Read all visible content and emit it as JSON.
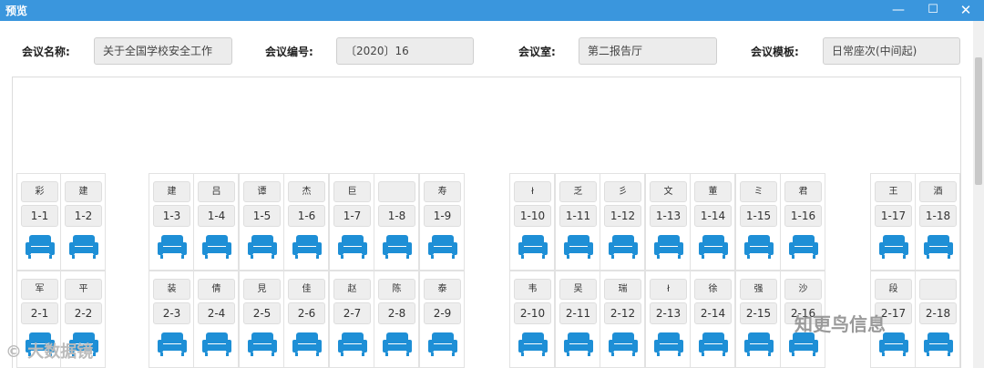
{
  "window": {
    "title": "预览",
    "minimize_glyph": "—",
    "maximize_glyph": "☐",
    "close_glyph": "✕"
  },
  "form": {
    "meeting_name_label": "会议名称:",
    "meeting_name_value": "关于全国学校安全工作",
    "meeting_number_label": "会议编号:",
    "meeting_number_value": "〔2020〕16",
    "meeting_room_label": "会议室:",
    "meeting_room_value": "第二报告厅",
    "meeting_template_label": "会议模板:",
    "meeting_template_value": "日常座次(中间起)"
  },
  "seats_row1": [
    {
      "num": "1-1",
      "name": "彩"
    },
    {
      "num": "1-2",
      "name": "建"
    },
    {
      "num": "1-3",
      "name": "建"
    },
    {
      "num": "1-4",
      "name": "吕"
    },
    {
      "num": "1-5",
      "name": "谭"
    },
    {
      "num": "1-6",
      "name": "杰"
    },
    {
      "num": "1-7",
      "name": "巨"
    },
    {
      "num": "1-8",
      "name": ""
    },
    {
      "num": "1-9",
      "name": "寿"
    },
    {
      "num": "1-10",
      "name": "ł"
    },
    {
      "num": "1-11",
      "name": "乏"
    },
    {
      "num": "1-12",
      "name": "彡"
    },
    {
      "num": "1-13",
      "name": "文"
    },
    {
      "num": "1-14",
      "name": "董"
    },
    {
      "num": "1-15",
      "name": "ミ"
    },
    {
      "num": "1-16",
      "name": "君"
    },
    {
      "num": "1-17",
      "name": "王"
    },
    {
      "num": "1-18",
      "name": "酒"
    }
  ],
  "seats_row2": [
    {
      "num": "2-1",
      "name": "军"
    },
    {
      "num": "2-2",
      "name": "平"
    },
    {
      "num": "2-3",
      "name": "装"
    },
    {
      "num": "2-4",
      "name": "倩"
    },
    {
      "num": "2-5",
      "name": "見"
    },
    {
      "num": "2-6",
      "name": "佳"
    },
    {
      "num": "2-7",
      "name": "赵"
    },
    {
      "num": "2-8",
      "name": "陈"
    },
    {
      "num": "2-9",
      "name": "泰"
    },
    {
      "num": "2-10",
      "name": "韦"
    },
    {
      "num": "2-11",
      "name": "吴"
    },
    {
      "num": "2-12",
      "name": "瑞"
    },
    {
      "num": "2-13",
      "name": "ł"
    },
    {
      "num": "2-14",
      "name": "徐"
    },
    {
      "num": "2-15",
      "name": "强"
    },
    {
      "num": "2-16",
      "name": "沙"
    },
    {
      "num": "2-17",
      "name": "段"
    },
    {
      "num": "2-18",
      "name": ""
    }
  ],
  "watermarks": {
    "left": "© 大数据镜",
    "right": "知更鸟信息"
  },
  "colors": {
    "titlebar": "#3a96dd",
    "chair_icon": "#1e8fd6"
  },
  "icons": {
    "chair": "armchair-icon",
    "minimize": "minimize-icon",
    "maximize": "maximize-icon",
    "close": "close-icon"
  }
}
